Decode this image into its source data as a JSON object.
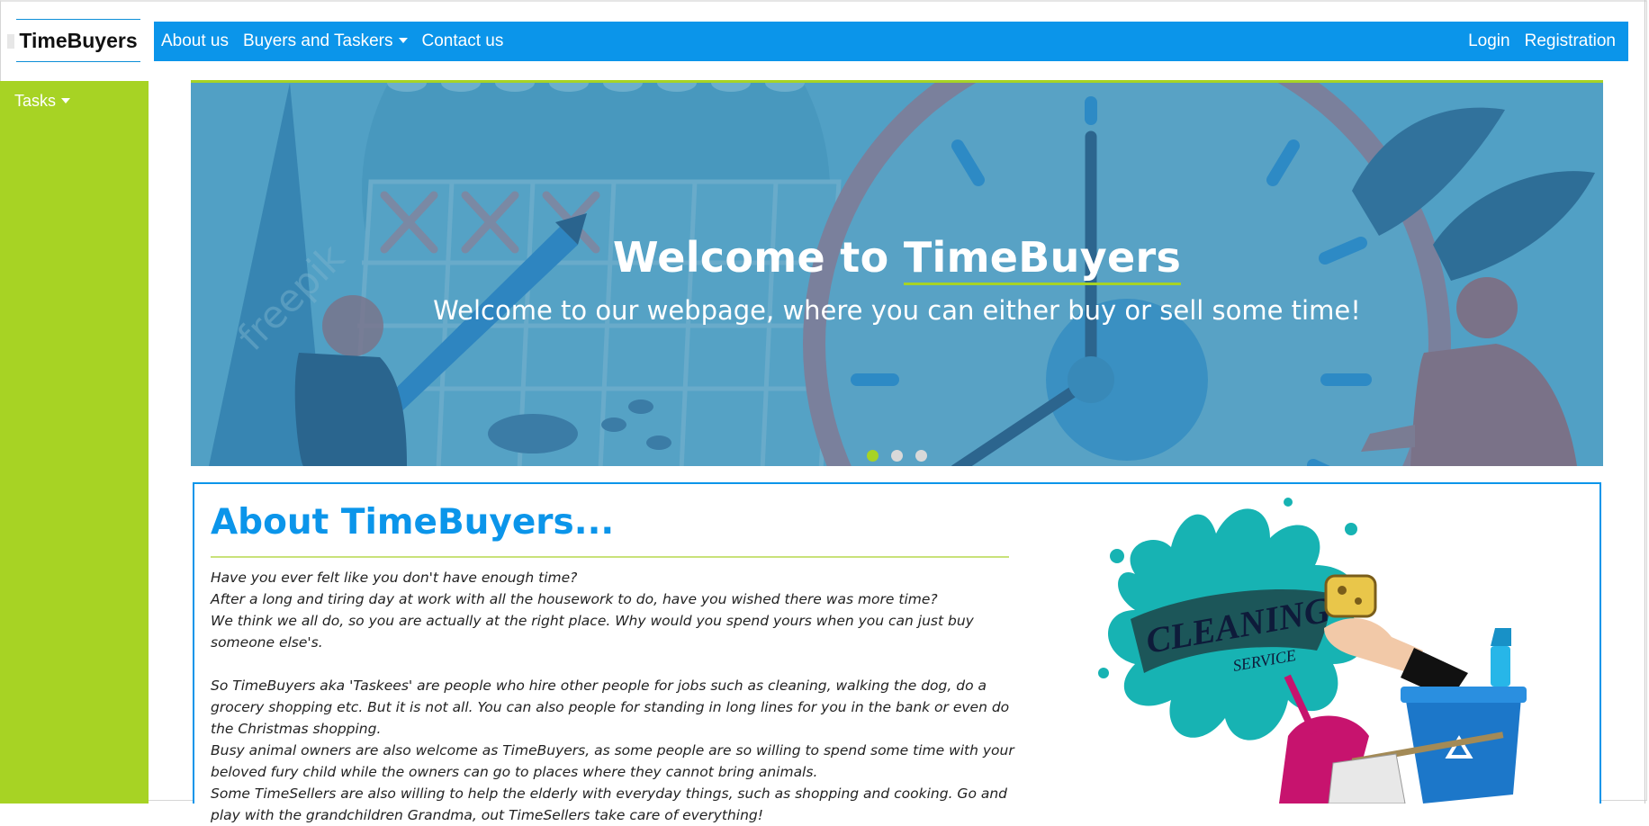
{
  "brand": {
    "name": "TimeBuyers"
  },
  "topnav": {
    "links": [
      "About us",
      "Buyers and Taskers",
      "Contact us"
    ],
    "auth": [
      "Login",
      "Registration"
    ]
  },
  "sidebar": {
    "tasks_label": "Tasks"
  },
  "hero": {
    "title_prefix": "Welcome to ",
    "title_brand": "TimeBuyers",
    "subtitle": "Welcome to our webpage, where you can either buy or sell some time!",
    "slide_count": 3,
    "active_slide": 1,
    "watermark": "freepik"
  },
  "about": {
    "title": "About TimeBuyers...",
    "paragraph1": [
      "Have you ever felt like you don't have enough time?",
      "After a long and tiring day at work with all the housework to do, have you wished there was more time?",
      "We think we all do, so you are actually at the right place. Why would you spend yours when you can just buy someone else's."
    ],
    "paragraph2": "So TimeBuyers aka 'Taskees' are people who hire other people for jobs such as cleaning, walking the dog, do a grocery shopping etc. But it is not all. You can also people for standing in long lines for you in the bank or even do the Christmas shopping.",
    "paragraph3": "Busy animal owners are also welcome as TimeBuyers, as some people are so willing to spend some time with your beloved fury child while the owners can go to places where they cannot bring animals.",
    "paragraph4": "Some TimeSellers are also willing to help the elderly with everyday things, such as shopping and cooking. Go and play with the grandchildren Grandma, out TimeSellers take care of everything!",
    "image_text_line1": "CLEANING",
    "image_text_line2": "SERVICE"
  },
  "colors": {
    "nav_blue": "#0b95ea",
    "sidebar_green": "#a7d324",
    "title_blue": "#0b95ea"
  }
}
